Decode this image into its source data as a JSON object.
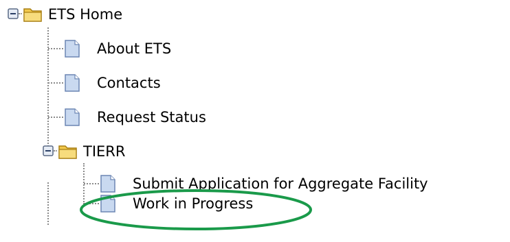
{
  "tree": {
    "root": {
      "label": "ETS Home",
      "expanded": true,
      "icon": "folder-open-icon",
      "children": [
        {
          "label": "About ETS",
          "icon": "page-icon"
        },
        {
          "label": "Contacts",
          "icon": "page-icon"
        },
        {
          "label": "Request Status",
          "icon": "page-icon"
        },
        {
          "label": "TIERR",
          "expanded": true,
          "icon": "folder-open-icon",
          "children": [
            {
              "label": "Submit Application for Aggregate Facility",
              "icon": "page-icon"
            },
            {
              "label": "Work in Progress",
              "icon": "page-icon",
              "highlighted": true
            }
          ]
        }
      ]
    }
  },
  "colors": {
    "connector": "#8a8a8a",
    "folder": "#f2c84b",
    "page": "#c9d9f0",
    "highlight": "#1a9a4a"
  }
}
